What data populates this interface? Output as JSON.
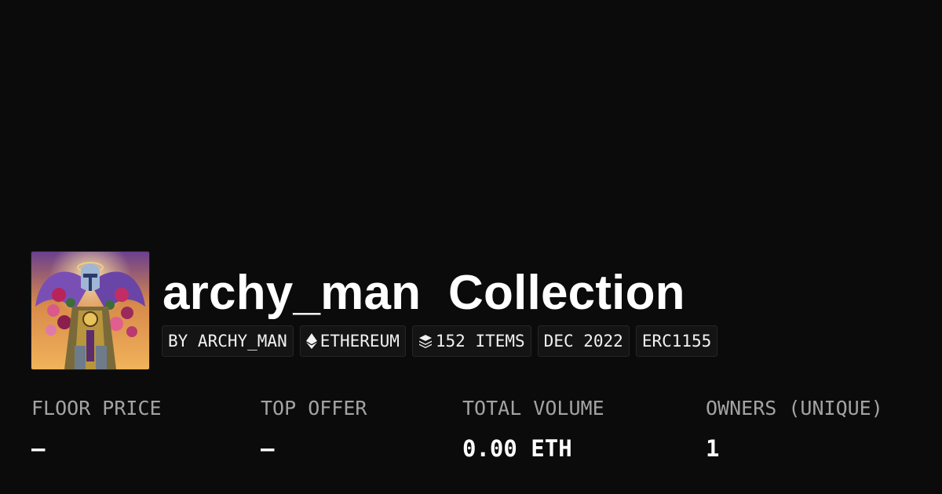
{
  "collection": {
    "name": "archy_man",
    "suffix": "Collection",
    "title": "archy_man  Collection"
  },
  "badges": [
    {
      "label": "BY ARCHY_MAN",
      "icon": ""
    },
    {
      "label": "ETHEREUM",
      "icon": "ethereum-icon"
    },
    {
      "label": "152 ITEMS",
      "icon": "layers-icon"
    },
    {
      "label": "DEC 2022",
      "icon": ""
    },
    {
      "label": "ERC1155",
      "icon": ""
    }
  ],
  "stats": [
    {
      "label": "FLOOR PRICE",
      "value": "–"
    },
    {
      "label": "TOP OFFER",
      "value": "–"
    },
    {
      "label": "TOTAL VOLUME",
      "value": "0.00 ETH"
    },
    {
      "label": "OWNERS (UNIQUE)",
      "value": "1"
    }
  ],
  "colors": {
    "background": "#0b0b0b",
    "text": "#ffffff",
    "muted": "#a3a3a3",
    "badge_bg": "#141414",
    "badge_border": "#262626"
  }
}
